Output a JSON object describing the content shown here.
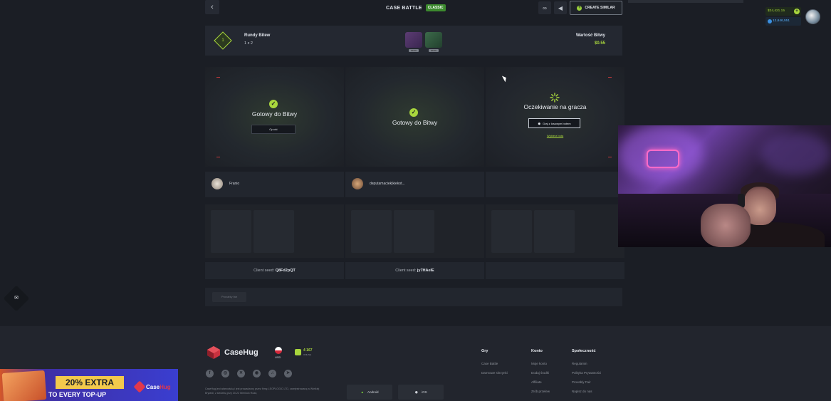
{
  "header": {
    "back_icon": "‹",
    "title": "CASE BATTLE",
    "mode_badge": "CLASSIC",
    "link_icon": "∞",
    "sound_icon": "◀",
    "create_similar_label": "CREATE SIMILAR",
    "create_similar_icon": "+"
  },
  "battle_info": {
    "round_number": "1",
    "rounds_label": "Rundy Bitew",
    "rounds_value": "1 z 2",
    "case_price_1": "$0.00",
    "case_price_2": "$0.00",
    "value_label": "Wartość Bitwy",
    "value_amount": "$0.55"
  },
  "arenas": [
    {
      "title": "Gotowy do Bitwy",
      "button": "Opuść",
      "check": "✓"
    },
    {
      "title": "Gotowy do Bitwy",
      "check": "✓"
    },
    {
      "title": "Oczekiwanie na gracza",
      "button": "Graj z losowym botem",
      "link": "Wybierz bota",
      "button_icon": "⬢"
    }
  ],
  "players": [
    {
      "name": "Franio"
    },
    {
      "name": "deputamaciek|kiekot..."
    },
    {
      "name": ""
    }
  ],
  "seeds": [
    {
      "label": "Client seed:",
      "value": "Q8Fd2pQT"
    },
    {
      "label": "Client seed:",
      "value": "jy7HAeIE"
    },
    {
      "label": "",
      "value": ""
    }
  ],
  "bottom": {
    "provably_fair_label": "Provably fair"
  },
  "account": {
    "balance_usd": "$24,421.15",
    "balance_plus": "+",
    "balance_coins": "12,646,551"
  },
  "chat_icon": "✉",
  "footer": {
    "brand_name": "CaseHug",
    "currency": "USD",
    "online_count": "4 167",
    "online_label": "ONLINE",
    "socials": [
      "f",
      "◎",
      "✕",
      "◉",
      "♫",
      "➤"
    ],
    "legal_text": "CaseHug jest własnością i jest prowadzony przez firmę LEOPLOGIC LTD, zarejestrowaną w Wielkiej Brytanii, z siedzibą przy 20-22 Wenlock Road,",
    "store_android": "Android",
    "store_ios": "iOS",
    "columns": [
      {
        "heading": "Gry",
        "links": [
          "Case Battle",
          "Darmowe skrzynki"
        ]
      },
      {
        "heading": "Konto",
        "links": [
          "Moje konto",
          "Dodaj środki",
          "Affiliate",
          "Zrób przelew"
        ]
      },
      {
        "heading": "Społeczność",
        "links": [
          "Regulamin",
          "Polityka Prywatności",
          "Provably Fair",
          "Napisz do nas"
        ]
      }
    ]
  },
  "promo": {
    "headline": "20% EXTRA",
    "subline": "TO EVERY TOP-UP",
    "brand_case": "Case",
    "brand_hug": "Hug"
  },
  "colors": {
    "accent_green": "#a8d63d",
    "danger_red": "#c0393b",
    "background": "#1b1e25"
  }
}
